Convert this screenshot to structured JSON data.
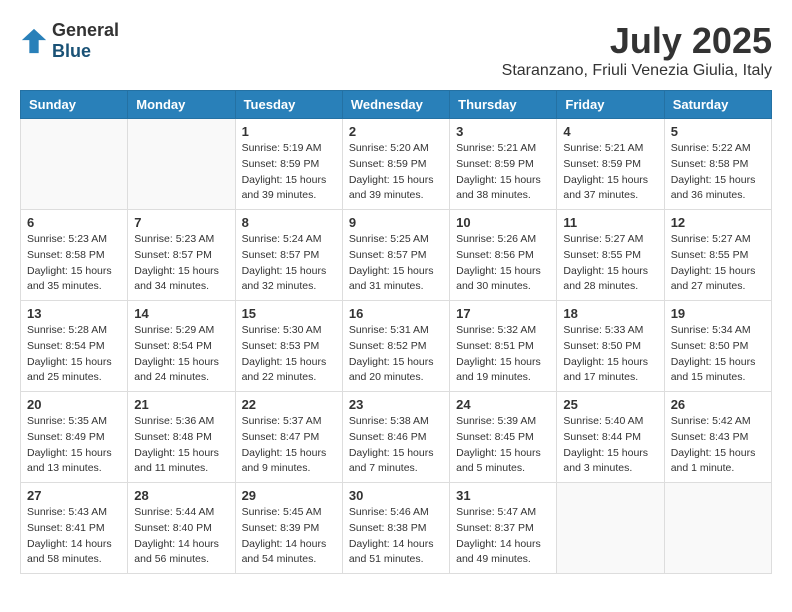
{
  "header": {
    "logo_general": "General",
    "logo_blue": "Blue",
    "month": "July 2025",
    "location": "Staranzano, Friuli Venezia Giulia, Italy"
  },
  "days_of_week": [
    "Sunday",
    "Monday",
    "Tuesday",
    "Wednesday",
    "Thursday",
    "Friday",
    "Saturday"
  ],
  "weeks": [
    [
      {
        "day": "",
        "sunrise": "",
        "sunset": "",
        "daylight": "",
        "empty": true
      },
      {
        "day": "",
        "sunrise": "",
        "sunset": "",
        "daylight": "",
        "empty": true
      },
      {
        "day": "1",
        "sunrise": "Sunrise: 5:19 AM",
        "sunset": "Sunset: 8:59 PM",
        "daylight": "Daylight: 15 hours and 39 minutes."
      },
      {
        "day": "2",
        "sunrise": "Sunrise: 5:20 AM",
        "sunset": "Sunset: 8:59 PM",
        "daylight": "Daylight: 15 hours and 39 minutes."
      },
      {
        "day": "3",
        "sunrise": "Sunrise: 5:21 AM",
        "sunset": "Sunset: 8:59 PM",
        "daylight": "Daylight: 15 hours and 38 minutes."
      },
      {
        "day": "4",
        "sunrise": "Sunrise: 5:21 AM",
        "sunset": "Sunset: 8:59 PM",
        "daylight": "Daylight: 15 hours and 37 minutes."
      },
      {
        "day": "5",
        "sunrise": "Sunrise: 5:22 AM",
        "sunset": "Sunset: 8:58 PM",
        "daylight": "Daylight: 15 hours and 36 minutes."
      }
    ],
    [
      {
        "day": "6",
        "sunrise": "Sunrise: 5:23 AM",
        "sunset": "Sunset: 8:58 PM",
        "daylight": "Daylight: 15 hours and 35 minutes."
      },
      {
        "day": "7",
        "sunrise": "Sunrise: 5:23 AM",
        "sunset": "Sunset: 8:57 PM",
        "daylight": "Daylight: 15 hours and 34 minutes."
      },
      {
        "day": "8",
        "sunrise": "Sunrise: 5:24 AM",
        "sunset": "Sunset: 8:57 PM",
        "daylight": "Daylight: 15 hours and 32 minutes."
      },
      {
        "day": "9",
        "sunrise": "Sunrise: 5:25 AM",
        "sunset": "Sunset: 8:57 PM",
        "daylight": "Daylight: 15 hours and 31 minutes."
      },
      {
        "day": "10",
        "sunrise": "Sunrise: 5:26 AM",
        "sunset": "Sunset: 8:56 PM",
        "daylight": "Daylight: 15 hours and 30 minutes."
      },
      {
        "day": "11",
        "sunrise": "Sunrise: 5:27 AM",
        "sunset": "Sunset: 8:55 PM",
        "daylight": "Daylight: 15 hours and 28 minutes."
      },
      {
        "day": "12",
        "sunrise": "Sunrise: 5:27 AM",
        "sunset": "Sunset: 8:55 PM",
        "daylight": "Daylight: 15 hours and 27 minutes."
      }
    ],
    [
      {
        "day": "13",
        "sunrise": "Sunrise: 5:28 AM",
        "sunset": "Sunset: 8:54 PM",
        "daylight": "Daylight: 15 hours and 25 minutes."
      },
      {
        "day": "14",
        "sunrise": "Sunrise: 5:29 AM",
        "sunset": "Sunset: 8:54 PM",
        "daylight": "Daylight: 15 hours and 24 minutes."
      },
      {
        "day": "15",
        "sunrise": "Sunrise: 5:30 AM",
        "sunset": "Sunset: 8:53 PM",
        "daylight": "Daylight: 15 hours and 22 minutes."
      },
      {
        "day": "16",
        "sunrise": "Sunrise: 5:31 AM",
        "sunset": "Sunset: 8:52 PM",
        "daylight": "Daylight: 15 hours and 20 minutes."
      },
      {
        "day": "17",
        "sunrise": "Sunrise: 5:32 AM",
        "sunset": "Sunset: 8:51 PM",
        "daylight": "Daylight: 15 hours and 19 minutes."
      },
      {
        "day": "18",
        "sunrise": "Sunrise: 5:33 AM",
        "sunset": "Sunset: 8:50 PM",
        "daylight": "Daylight: 15 hours and 17 minutes."
      },
      {
        "day": "19",
        "sunrise": "Sunrise: 5:34 AM",
        "sunset": "Sunset: 8:50 PM",
        "daylight": "Daylight: 15 hours and 15 minutes."
      }
    ],
    [
      {
        "day": "20",
        "sunrise": "Sunrise: 5:35 AM",
        "sunset": "Sunset: 8:49 PM",
        "daylight": "Daylight: 15 hours and 13 minutes."
      },
      {
        "day": "21",
        "sunrise": "Sunrise: 5:36 AM",
        "sunset": "Sunset: 8:48 PM",
        "daylight": "Daylight: 15 hours and 11 minutes."
      },
      {
        "day": "22",
        "sunrise": "Sunrise: 5:37 AM",
        "sunset": "Sunset: 8:47 PM",
        "daylight": "Daylight: 15 hours and 9 minutes."
      },
      {
        "day": "23",
        "sunrise": "Sunrise: 5:38 AM",
        "sunset": "Sunset: 8:46 PM",
        "daylight": "Daylight: 15 hours and 7 minutes."
      },
      {
        "day": "24",
        "sunrise": "Sunrise: 5:39 AM",
        "sunset": "Sunset: 8:45 PM",
        "daylight": "Daylight: 15 hours and 5 minutes."
      },
      {
        "day": "25",
        "sunrise": "Sunrise: 5:40 AM",
        "sunset": "Sunset: 8:44 PM",
        "daylight": "Daylight: 15 hours and 3 minutes."
      },
      {
        "day": "26",
        "sunrise": "Sunrise: 5:42 AM",
        "sunset": "Sunset: 8:43 PM",
        "daylight": "Daylight: 15 hours and 1 minute."
      }
    ],
    [
      {
        "day": "27",
        "sunrise": "Sunrise: 5:43 AM",
        "sunset": "Sunset: 8:41 PM",
        "daylight": "Daylight: 14 hours and 58 minutes."
      },
      {
        "day": "28",
        "sunrise": "Sunrise: 5:44 AM",
        "sunset": "Sunset: 8:40 PM",
        "daylight": "Daylight: 14 hours and 56 minutes."
      },
      {
        "day": "29",
        "sunrise": "Sunrise: 5:45 AM",
        "sunset": "Sunset: 8:39 PM",
        "daylight": "Daylight: 14 hours and 54 minutes."
      },
      {
        "day": "30",
        "sunrise": "Sunrise: 5:46 AM",
        "sunset": "Sunset: 8:38 PM",
        "daylight": "Daylight: 14 hours and 51 minutes."
      },
      {
        "day": "31",
        "sunrise": "Sunrise: 5:47 AM",
        "sunset": "Sunset: 8:37 PM",
        "daylight": "Daylight: 14 hours and 49 minutes."
      },
      {
        "day": "",
        "sunrise": "",
        "sunset": "",
        "daylight": "",
        "empty": true
      },
      {
        "day": "",
        "sunrise": "",
        "sunset": "",
        "daylight": "",
        "empty": true
      }
    ]
  ]
}
